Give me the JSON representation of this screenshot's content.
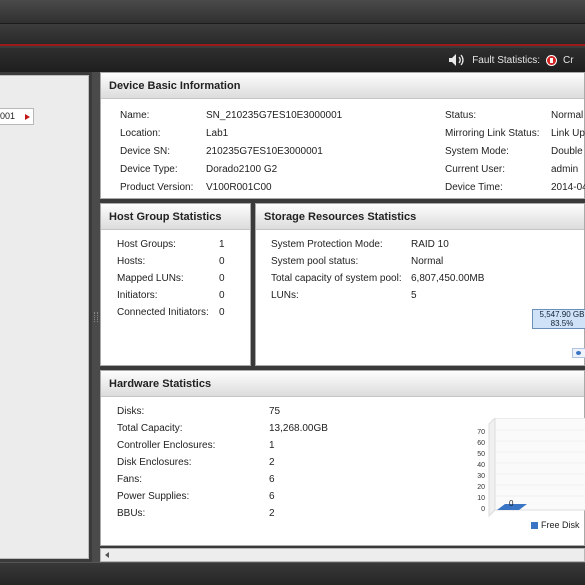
{
  "header": {
    "fault_statistics_label": "Fault Statistics:",
    "critical_label": "Cr",
    "colors": {
      "accent_line": "#9b1b1b",
      "critical": "#d32222"
    }
  },
  "tree": {
    "selected_node_label": "001"
  },
  "device_basic": {
    "title": "Device Basic Information",
    "left": [
      {
        "label": "Name:",
        "value": "SN_210235G7ES10E3000001"
      },
      {
        "label": "Location:",
        "value": "Lab1"
      },
      {
        "label": "Device SN:",
        "value": "210235G7ES10E3000001"
      },
      {
        "label": "Device Type:",
        "value": "Dorado2100 G2"
      },
      {
        "label": "Product Version:",
        "value": "V100R001C00"
      }
    ],
    "right": [
      {
        "label": "Status:",
        "value": "Normal"
      },
      {
        "label": "Mirroring Link Status:",
        "value": "Link Up"
      },
      {
        "label": "System Mode:",
        "value": "Double"
      },
      {
        "label": "Current User:",
        "value": "admin"
      },
      {
        "label": "Device Time:",
        "value": "2014-04"
      }
    ]
  },
  "host_group": {
    "title": "Host Group Statistics",
    "rows": [
      {
        "label": "Host Groups:",
        "value": "1"
      },
      {
        "label": "Hosts:",
        "value": "0"
      },
      {
        "label": "Mapped LUNs:",
        "value": "0"
      },
      {
        "label": "Initiators:",
        "value": "0"
      },
      {
        "label": "Connected Initiators:",
        "value": "0"
      }
    ]
  },
  "storage": {
    "title": "Storage Resources Statistics",
    "rows": [
      {
        "label": "System Protection Mode:",
        "value": "RAID 10"
      },
      {
        "label": "System pool status:",
        "value": "Normal"
      },
      {
        "label": "Total capacity of system pool:",
        "value": "6,807,450.00MB"
      },
      {
        "label": "LUNs:",
        "value": "5"
      }
    ],
    "tooltip_line1": "5,547.90 GB",
    "tooltip_line2": "83.5%"
  },
  "hardware": {
    "title": "Hardware Statistics",
    "rows": [
      {
        "label": "Disks:",
        "value": "75"
      },
      {
        "label": "Total Capacity:",
        "value": "13,268.00GB"
      },
      {
        "label": "Controller Enclosures:",
        "value": "1"
      },
      {
        "label": "Disk Enclosures:",
        "value": "2"
      },
      {
        "label": "Fans:",
        "value": "6"
      },
      {
        "label": "Power Supplies:",
        "value": "6"
      },
      {
        "label": "BBUs:",
        "value": "2"
      }
    ],
    "chart": {
      "y_ticks": [
        "70",
        "60",
        "50",
        "40",
        "30",
        "20",
        "10",
        "0"
      ],
      "bar_value_label": "0",
      "legend_label": "Free Disk",
      "series_color": "#3a74c4"
    }
  }
}
